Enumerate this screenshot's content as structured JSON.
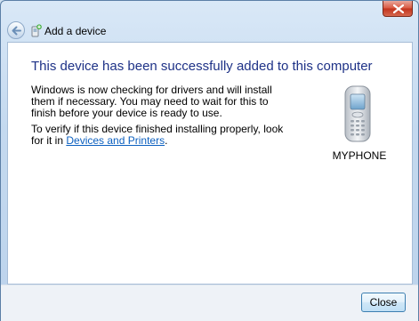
{
  "window": {
    "title": "Add a device",
    "title_icon": "add-device-icon",
    "close_icon": "close-icon",
    "back_icon": "back-arrow-icon"
  },
  "content": {
    "heading": "This device has been successfully added to this computer",
    "paragraph1": "Windows is now checking for drivers and will install them if necessary. You may need to wait for this to finish before your device is ready to use.",
    "paragraph2_prefix": "To verify if this device finished installing properly, look for it in",
    "paragraph2_link": "Devices and Printers",
    "paragraph2_suffix": ".",
    "device_name": "MYPHONE",
    "device_icon": "mobile-phone-icon"
  },
  "footer": {
    "close_label": "Close"
  },
  "colors": {
    "heading": "#1e3287",
    "link": "#0b5fbf",
    "close_red": "#d9573f"
  }
}
